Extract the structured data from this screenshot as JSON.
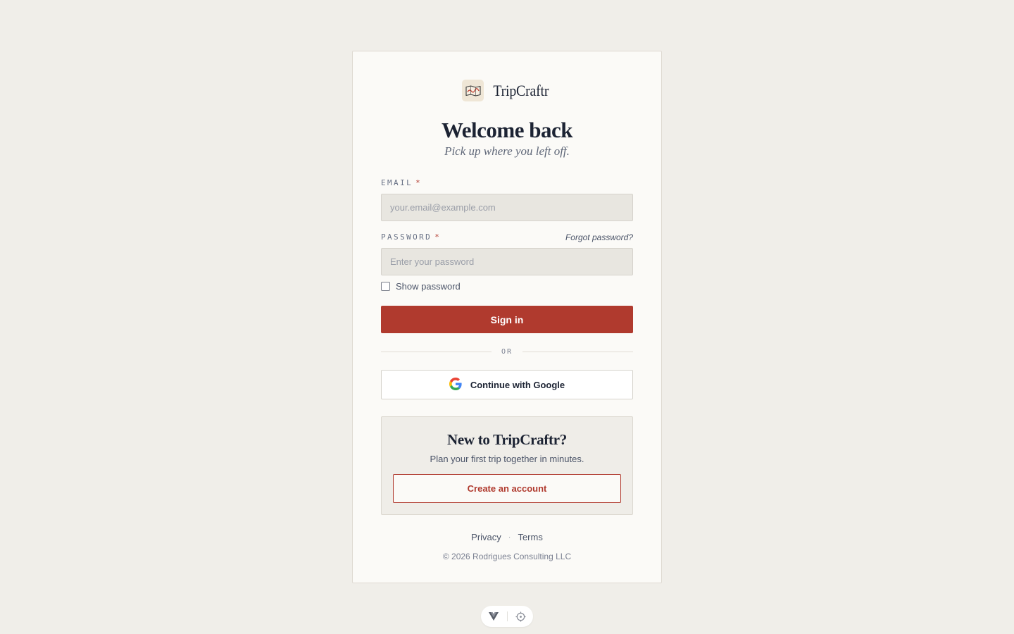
{
  "brand": {
    "name": "TripCraftr",
    "logo_icon": "map-icon"
  },
  "heading": {
    "title": "Welcome back",
    "subtitle": "Pick up where you left off."
  },
  "form": {
    "email": {
      "label": "EMAIL",
      "required_mark": "*",
      "placeholder": "your.email@example.com",
      "value": ""
    },
    "password": {
      "label": "PASSWORD",
      "required_mark": "*",
      "placeholder": "Enter your password",
      "value": "",
      "forgot_link": "Forgot password?"
    },
    "show_password": {
      "label": "Show password",
      "checked": false
    },
    "submit_label": "Sign in"
  },
  "divider": {
    "text": "OR"
  },
  "google": {
    "label": "Continue with Google",
    "icon": "google-icon"
  },
  "signup": {
    "title": "New to TripCraftr?",
    "subtitle": "Plan your first trip together in minutes.",
    "button_label": "Create an account"
  },
  "footer": {
    "links": [
      "Privacy",
      "Terms"
    ],
    "separator": "·",
    "copyright": "© 2026 Rodrigues Consulting LLC"
  },
  "dev_toolbar": {
    "icons": [
      "vue-icon",
      "crosshair-icon"
    ]
  },
  "colors": {
    "background": "#f0eee9",
    "card": "#fbfaf7",
    "accent": "#b03a2e",
    "text": "#1c2333",
    "input_bg": "#e8e6e0"
  }
}
